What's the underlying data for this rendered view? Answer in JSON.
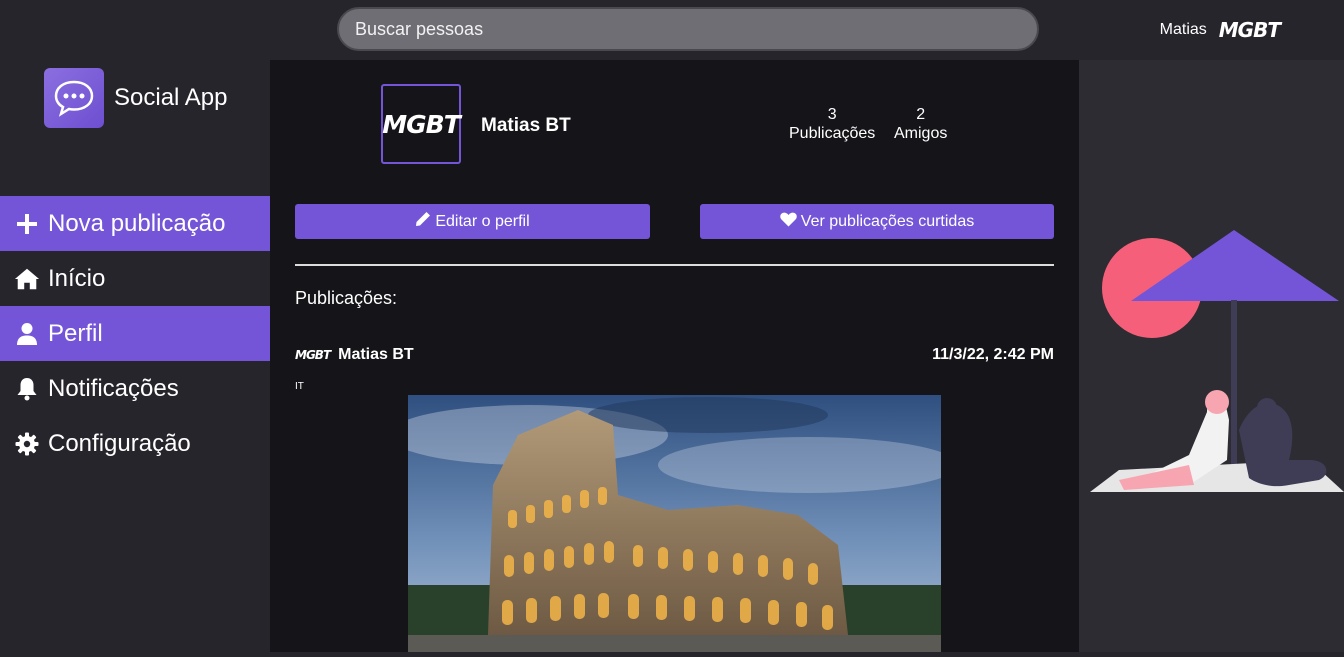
{
  "header": {
    "search_placeholder": "Buscar pessoas",
    "user_name": "Matias",
    "user_logo_text": "MGBT"
  },
  "sidebar": {
    "app_name": "Social App",
    "items": [
      {
        "label": "Nova publicação",
        "icon": "plus-icon",
        "active": true
      },
      {
        "label": "Início",
        "icon": "home-icon",
        "active": false
      },
      {
        "label": "Perfil",
        "icon": "user-icon",
        "active": true
      },
      {
        "label": "Notificações",
        "icon": "bell-icon",
        "active": false
      },
      {
        "label": "Configuração",
        "icon": "gear-icon",
        "active": false
      }
    ]
  },
  "profile": {
    "avatar_text": "MGBT",
    "name": "Matias BT",
    "posts_count": "3",
    "posts_label": "Publicações",
    "friends_count": "2",
    "friends_label": "Amigos",
    "edit_button": "Editar o perfil",
    "liked_button": "Ver publicações curtidas"
  },
  "feed": {
    "section_title": "Publicações:",
    "posts": [
      {
        "avatar_text": "MGBT",
        "author": "Matias BT",
        "date": "11/3/22, 2:42 PM",
        "text": "IT"
      }
    ]
  },
  "colors": {
    "accent": "#7455d8",
    "background": "#26252c",
    "main_background": "#151419",
    "illustration_sun": "#f65f79"
  }
}
